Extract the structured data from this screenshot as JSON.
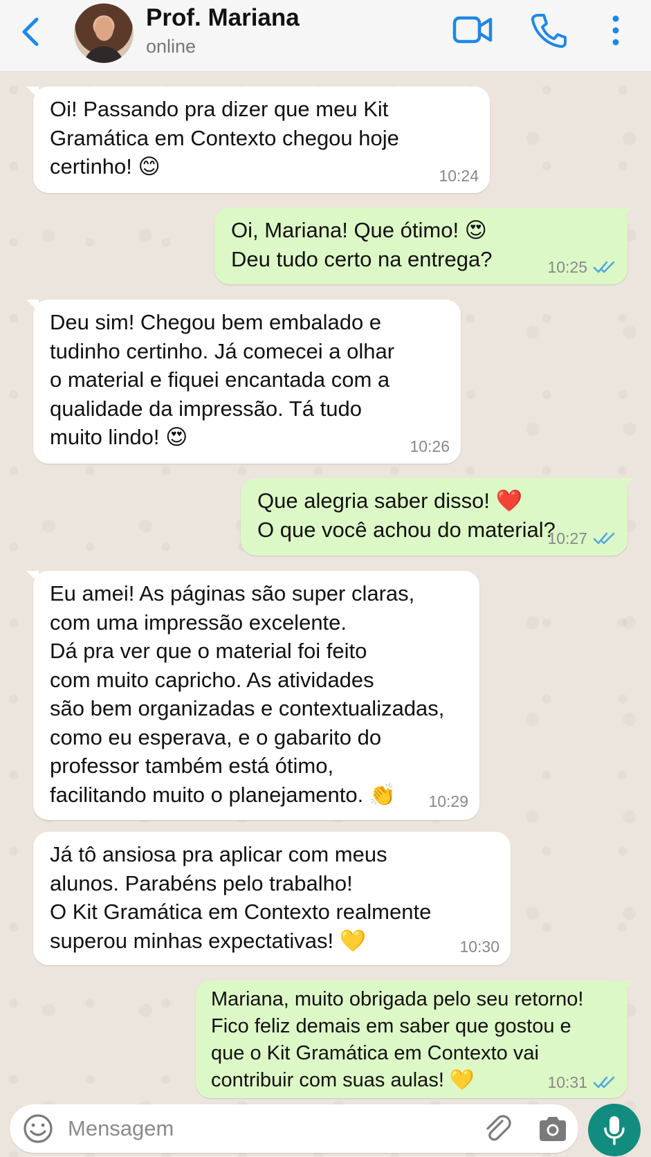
{
  "header": {
    "contact_name": "Prof. Mariana",
    "status": "online",
    "icons": [
      "back-chevron-icon",
      "video-call-icon",
      "phone-call-icon",
      "more-vertical-icon"
    ],
    "accent_color": "#1e88e5"
  },
  "messages": [
    {
      "direction": "incoming",
      "text": "Oi! Passando pra dizer que meu Kit\nGramática em Contexto chegou hoje\ncertinho! 😊",
      "time": "10:24"
    },
    {
      "direction": "outgoing",
      "text": "Oi, Mariana! Que ótimo! 😍\nDeu tudo certo na entrega?",
      "time": "10:25",
      "read": true
    },
    {
      "direction": "incoming",
      "text": "Deu sim! Chegou bem embalado e\ntudinho certinho. Já comecei a olhar\no material e fiquei encantada com a\nqualidade da impressão. Tá tudo\nmuito lindo! 😍",
      "time": "10:26"
    },
    {
      "direction": "outgoing",
      "text": "Que alegria saber disso! ❤️\nO que você achou do material?",
      "time": "10:27",
      "read": true
    },
    {
      "direction": "incoming",
      "text": "Eu amei! As páginas são super claras,\ncom uma impressão excelente.\nDá pra ver que o material foi feito\ncom muito capricho. As atividades\nsão bem organizadas e contextualizadas,\ncomo eu esperava, e o gabarito do\nprofessor também está ótimo,\nfacilitando muito o planejamento. 👏",
      "time": "10:29"
    },
    {
      "direction": "incoming",
      "text": "Já tô ansiosa pra aplicar com meus\nalunos. Parabéns pelo trabalho!\nO Kit Gramática em Contexto realmente\nsuperou minhas expectativas! 💛",
      "time": "10:30"
    },
    {
      "direction": "outgoing",
      "text": "Mariana, muito obrigada pelo seu retorno!\nFico feliz demais em saber que gostou e\nque o Kit Gramática em Contexto vai\ncontribuir com suas aulas! 💛",
      "time": "10:31",
      "read": true
    }
  ],
  "composer": {
    "placeholder": "Mensagem",
    "icons": [
      "emoji-icon",
      "paperclip-icon",
      "camera-icon",
      "microphone-icon"
    ]
  },
  "colors": {
    "incoming_bubble": "#ffffff",
    "outgoing_bubble": "#dcf8c6",
    "read_ticks": "#4fa8e0",
    "mic_button": "#128c7e",
    "chat_background": "#ece5dd"
  }
}
